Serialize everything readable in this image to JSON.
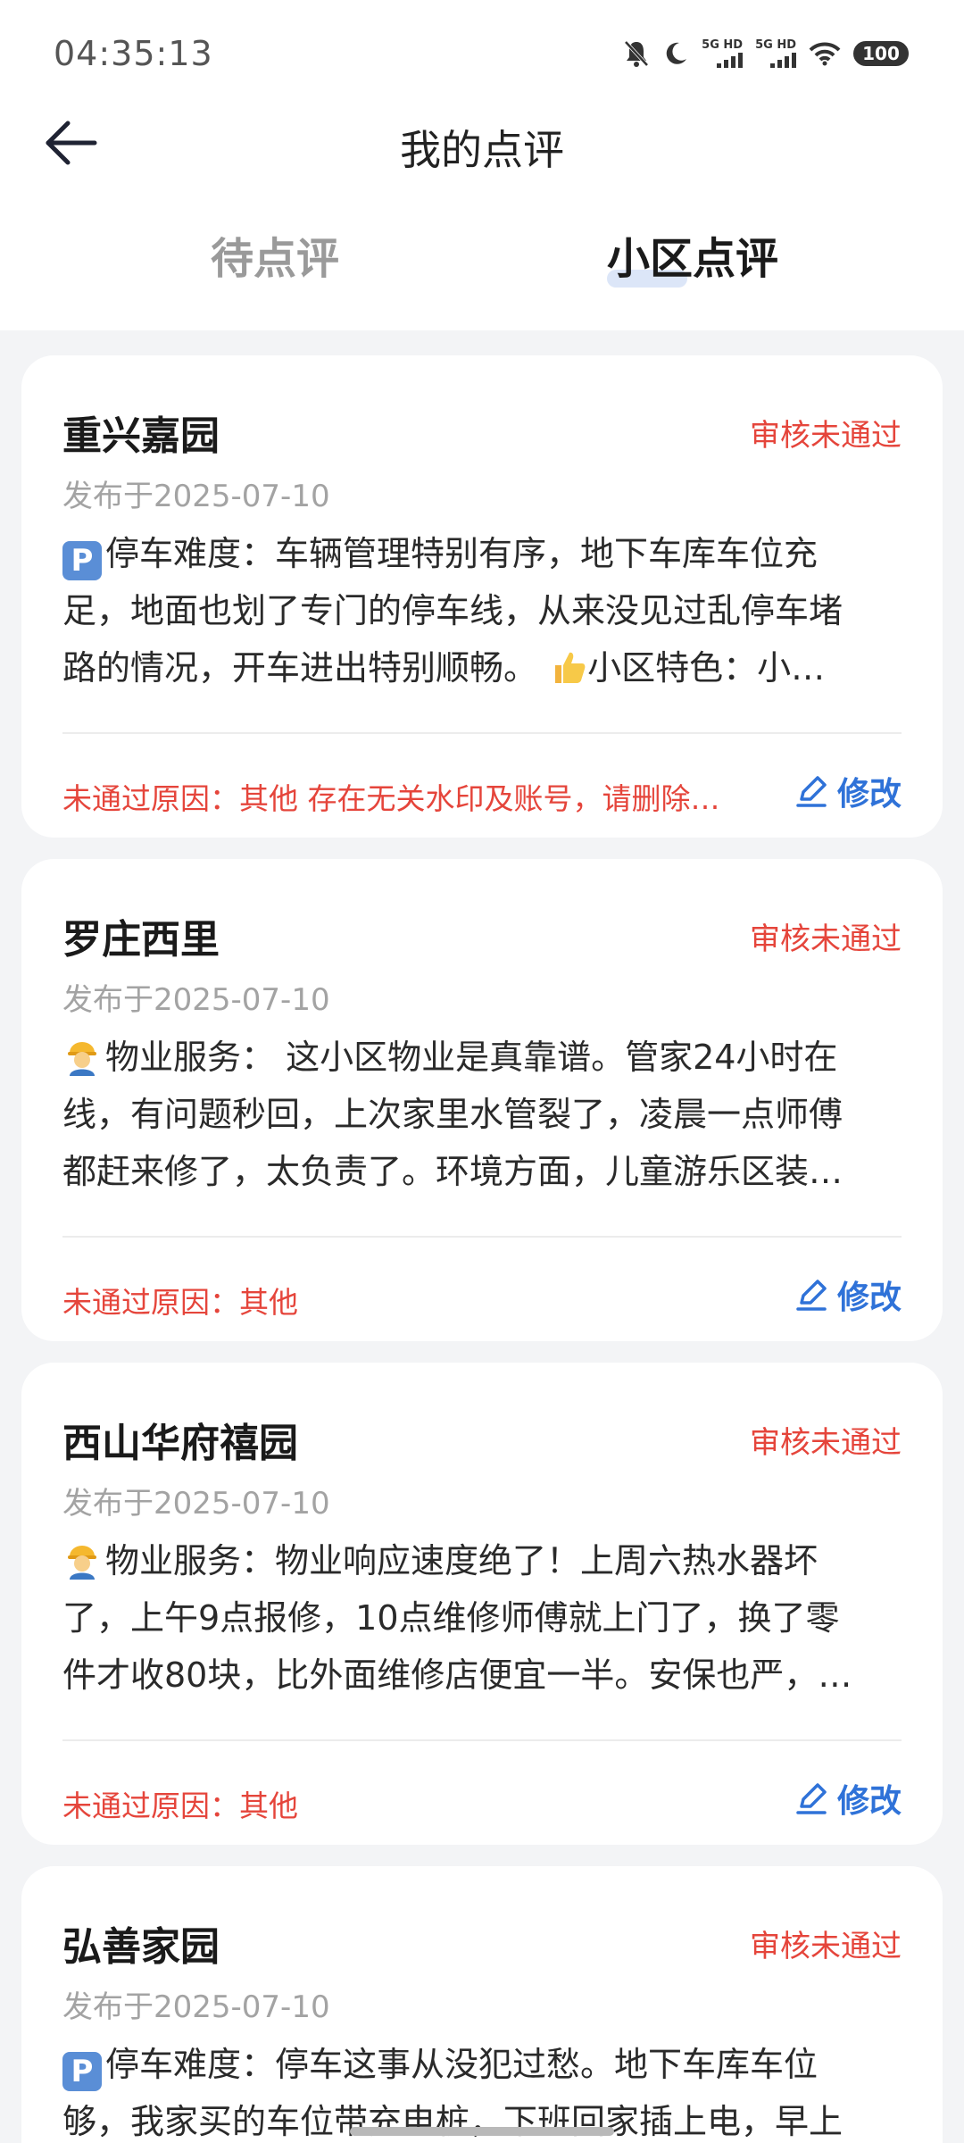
{
  "status_bar": {
    "time": "04:35:13",
    "signal_1": "5G HD",
    "signal_2": "5G HD",
    "battery": "100"
  },
  "nav": {
    "title": "我的点评"
  },
  "tabs": [
    {
      "label": "待点评",
      "active": false
    },
    {
      "label": "小区点评",
      "active": true
    }
  ],
  "reviews": [
    {
      "name": "重兴嘉园",
      "status": "审核未通过",
      "date": "发布于2025-07-10",
      "content_lines": [
        "停车难度：车辆管理特别有序，地下车库车位充",
        "足，地面也划了专门的停车线，从来没见过乱停车堵",
        "路的情况，开车进出特别顺畅。 ",
        "小区特色：小…"
      ],
      "reason": "未通过原因：其他 存在无关水印及账号，请删除…",
      "edit_label": "修改"
    },
    {
      "name": "罗庄西里",
      "status": "审核未通过",
      "date": "发布于2025-07-10",
      "content_lines": [
        "物业服务： 这小区物业是真靠谱。管家24小时在",
        "线，有问题秒回，上次家里水管裂了，凌晨一点师傅",
        "都赶来修了，太负责了。环境方面，儿童游乐区装…"
      ],
      "reason": "未通过原因：其他",
      "edit_label": "修改"
    },
    {
      "name": "西山华府禧园",
      "status": "审核未通过",
      "date": "发布于2025-07-10",
      "content_lines": [
        "物业服务：物业响应速度绝了！上周六热水器坏",
        "了，上午9点报修，10点维修师傅就上门了，换了零",
        "件才收80块，比外面维修店便宜一半。安保也严，…"
      ],
      "reason": "未通过原因：其他",
      "edit_label": "修改"
    },
    {
      "name": "弘善家园",
      "status": "审核未通过",
      "date": "发布于2025-07-10",
      "content_lines": [
        "停车难度：停车这事从没犯过愁。地下车库车位",
        "够，我家买的车位带充电桩，下班回家插上电，早上"
      ],
      "reason": "",
      "edit_label": ""
    }
  ],
  "colors": {
    "status_red": "#e5453b",
    "edit_blue": "#2f72d8",
    "background": "#f3f4f6"
  },
  "icons": {
    "back": "arrow-left-icon",
    "edit": "edit-pencil-icon",
    "parking": "parking-emoji-icon",
    "worker": "worker-emoji-icon",
    "thumbs_up": "thumbs-up-emoji-icon"
  }
}
